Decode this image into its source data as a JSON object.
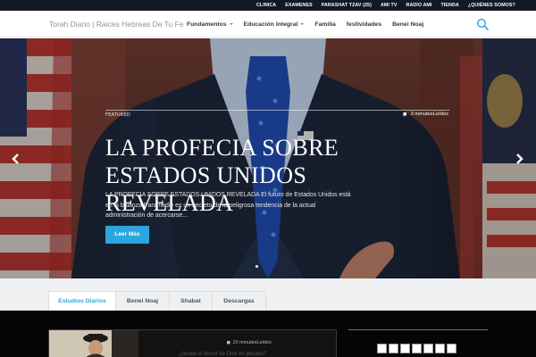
{
  "topbar": {
    "items": [
      "CLINICA",
      "EXAMENES",
      "PARASHAT TZAV (25)",
      "AMI TV",
      "RADIO AMI",
      "TIENDA",
      "¿QUIÉNES SOMOS?"
    ]
  },
  "header": {
    "brand": "Torah Diario | Raices Hebreas De Tu Fe",
    "nav": [
      {
        "label": "Fundamentos",
        "dropdown": true
      },
      {
        "label": "Educación Integral",
        "dropdown": true
      },
      {
        "label": "Familia",
        "dropdown": false
      },
      {
        "label": "festividades",
        "dropdown": false
      },
      {
        "label": "Benei Noaj",
        "dropdown": false
      }
    ],
    "search_icon": "search-icon"
  },
  "hero": {
    "category": "FEATURED",
    "read_time": "3 minutesLeídos",
    "title": "LA PROFECIA SOBRE ESTADOS UNIDOS REVELADA",
    "excerpt": "LA PROFECIA SOBRE ESTADOS UNIDOS REVELADA El futuro de Estados Unidos está en la balanza Para nadie es un secreto de la peligrosa tendencia de la actual administración de acercarse...",
    "button": "Leer Más",
    "prev_icon": "chevron-left-icon",
    "next_icon": "chevron-right-icon"
  },
  "tabs": {
    "items": [
      "Estudios Diarios",
      "Benei Noaj",
      "Shabat",
      "Descargas"
    ],
    "active_index": 0
  },
  "feed": {
    "card_read_time": "10 minutesLeídos",
    "card_title": "¿Acaso el temor de Dios es pecado?"
  },
  "colors": {
    "accent": "#2ba6de",
    "topbar_bg": "#111a24",
    "dark_bg": "#050505"
  }
}
